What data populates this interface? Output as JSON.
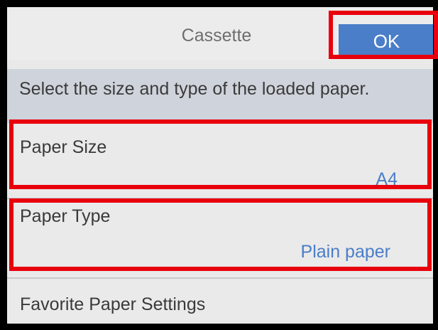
{
  "header": {
    "title": "Cassette",
    "ok_label": "OK"
  },
  "message": "Select the size and type of the loaded paper.",
  "settings": [
    {
      "label": "Paper Size",
      "value": "A4"
    },
    {
      "label": "Paper Type",
      "value": "Plain paper"
    },
    {
      "label": "Favorite Paper Settings"
    }
  ],
  "colors": {
    "accent": "#4a7ec8",
    "highlight": "#e8000d",
    "message_bg": "#cfd3db"
  }
}
